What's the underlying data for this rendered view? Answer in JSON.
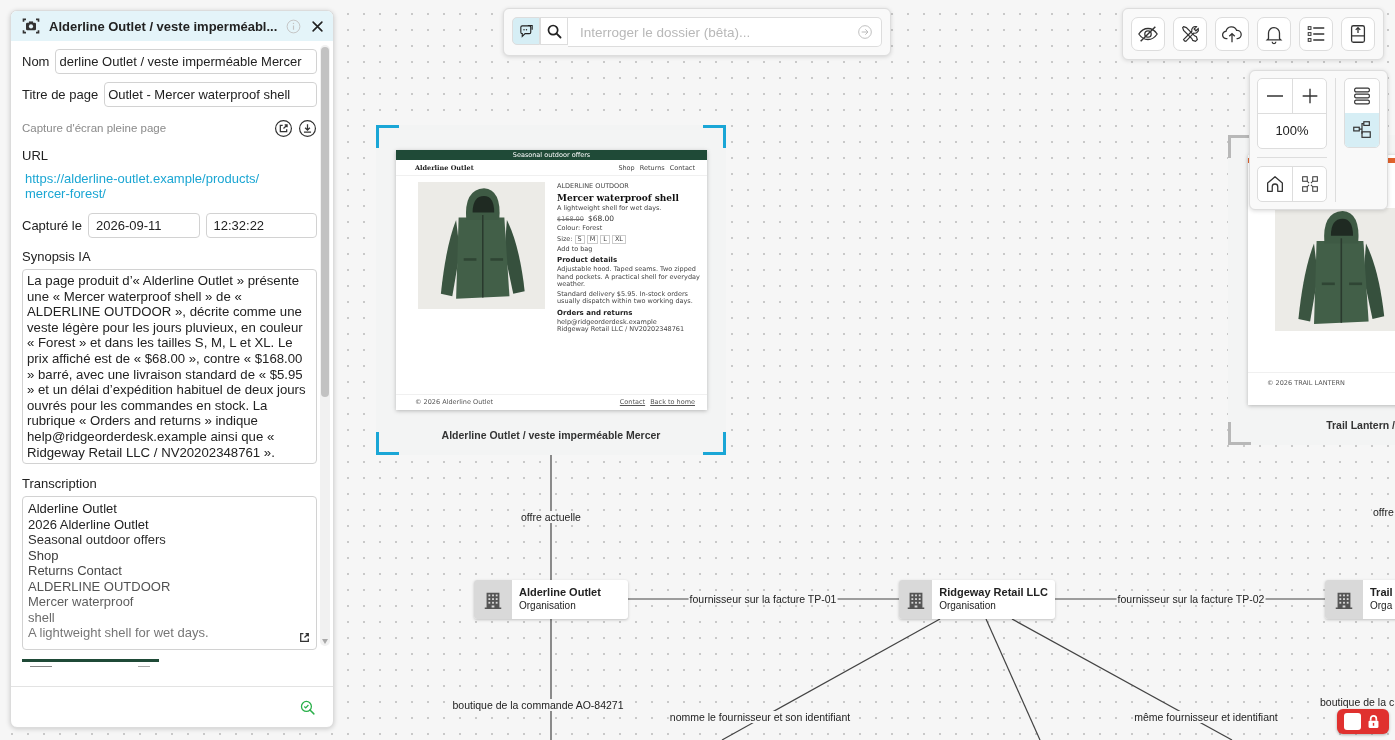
{
  "panel": {
    "title": "Alderline Outlet / veste imperméabl...",
    "fields": [
      {
        "label": "Nom",
        "value": "derline Outlet / veste imperméable Mercer"
      },
      {
        "label": "Titre de page",
        "value": "Outlet - Mercer waterproof shell"
      }
    ],
    "screenshot_label": "Capture d'écran pleine page",
    "url_label": "URL",
    "url": "https://alderline-outlet.example/products/mercer-forest/",
    "captured_label": "Capturé le",
    "date": "2026-09-11",
    "time": "12:32:22",
    "synopsis_label": "Synopsis IA",
    "synopsis": "La page produit d’« Alderline Outlet » présente une « Mercer waterproof shell » de « ALDERLINE OUTDOOR », décrite comme une veste légère pour les jours pluvieux, en couleur « Forest » et dans les tailles S, M, L et XL. Le prix affiché est de « $68.00 », contre « $168.00 » barré, avec une livraison standard de « $5.95 » et un délai d’expédition habituel de deux jours ouvrés pour les commandes en stock. La rubrique « Orders and returns » indique help@ridgeorderdesk.example ainsi que « Ridgeway Retail LLC / NV20202348761 ».",
    "transcription_label": "Transcription",
    "transcription_lines": [
      "Alderline Outlet",
      "2026 Alderline Outlet",
      "Seasonal outdoor offers",
      "Shop",
      "Returns Contact",
      "ALDERLINE OUTDOOR",
      "Mercer waterproof",
      "shell",
      "A lightweight shell for wet days."
    ]
  },
  "search": {
    "modes": [
      {
        "kind": "chat",
        "selected": true
      },
      {
        "kind": "search",
        "selected": false
      }
    ],
    "placeholder": "Interroger le dossier (bêta)..."
  },
  "toolbar": [
    {
      "kind": "hide"
    },
    {
      "kind": "tools"
    },
    {
      "kind": "upload"
    },
    {
      "kind": "notifications"
    },
    {
      "kind": "checklist"
    },
    {
      "kind": "export"
    }
  ],
  "zoom": {
    "level_text": "100%",
    "views": [
      {
        "kind": "list",
        "selected": false
      },
      {
        "kind": "tree",
        "selected": true
      }
    ]
  },
  "canvas": {
    "screenshots": [
      {
        "label": "Alderline Outlet / veste imperméable Mercer",
        "selected": true,
        "page": {
          "kind": "product",
          "banner": "Seasonal outdoor offers",
          "brand": "Alderline Outlet",
          "nav": [
            "Shop",
            "Returns",
            "Contact"
          ],
          "vendor": "ALDERLINE OUTDOOR",
          "product": "Mercer waterproof shell",
          "tagline": "A lightweight shell for wet days.",
          "old_price": "$168.00",
          "price": "$68.00",
          "colour": "Colour: Forest",
          "size_label": "Size:",
          "sizes": [
            "S",
            "M",
            "L",
            "XL"
          ],
          "add": "Add to bag",
          "details_heading": "Product details",
          "details": [
            "Adjustable hood. Taped seams. Two zipped hand pockets. A practical shell for everyday weather.",
            "Standard delivery $5.95. In-stock orders usually dispatch within two working days."
          ],
          "orders_heading": "Orders and returns",
          "orders": [
            "help@ridgeorderdesk.example",
            "Ridgeway Retail LLC / NV20202348761"
          ],
          "copyright": "© 2026 Alderline Outlet",
          "footer_links": [
            "Contact",
            "Back to home"
          ]
        }
      },
      {
        "label": "Trail Lantern /",
        "selected": false,
        "page": {
          "kind": "partial",
          "copyright": "© 2026 TRAIL LANTERN"
        }
      }
    ],
    "organisations": [
      {
        "name": "Alderline Outlet",
        "type": "Organisation"
      },
      {
        "name": "Ridgeway Retail LLC",
        "type": "Organisation"
      },
      {
        "name": "Trail",
        "type": "Orga"
      }
    ],
    "edges": [
      {
        "label": "offre actuelle"
      },
      {
        "label": "offre"
      },
      {
        "label": "fournisseur sur la facture TP-01"
      },
      {
        "label": "fournisseur sur la facture TP-02"
      },
      {
        "label": "boutique de la commande AO-84271"
      },
      {
        "label": "boutique de la c"
      },
      {
        "label": "nomme le fournisseur et son identifiant"
      },
      {
        "label": "même fournisseur et identifiant"
      }
    ]
  }
}
